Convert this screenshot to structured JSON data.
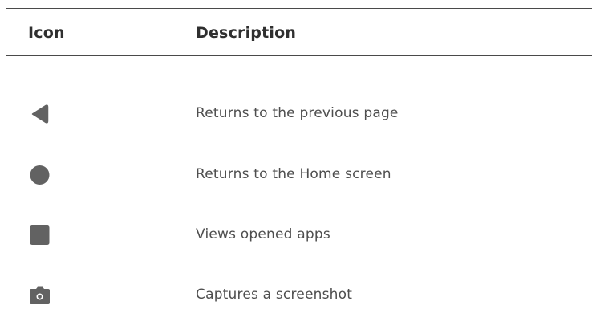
{
  "table": {
    "headers": {
      "icon": "Icon",
      "description": "Description"
    },
    "rows": [
      {
        "icon": "back-triangle-icon",
        "description": "Returns to the previous page"
      },
      {
        "icon": "home-circle-icon",
        "description": "Returns to the Home screen"
      },
      {
        "icon": "recent-apps-square-icon",
        "description": "Views opened apps"
      },
      {
        "icon": "camera-icon",
        "description": "Captures a screenshot"
      }
    ]
  },
  "colors": {
    "icon_fill": "#626262",
    "header_text": "#2f2f2f",
    "body_text": "#4e4e4e",
    "rule": "#4a4a4a"
  }
}
